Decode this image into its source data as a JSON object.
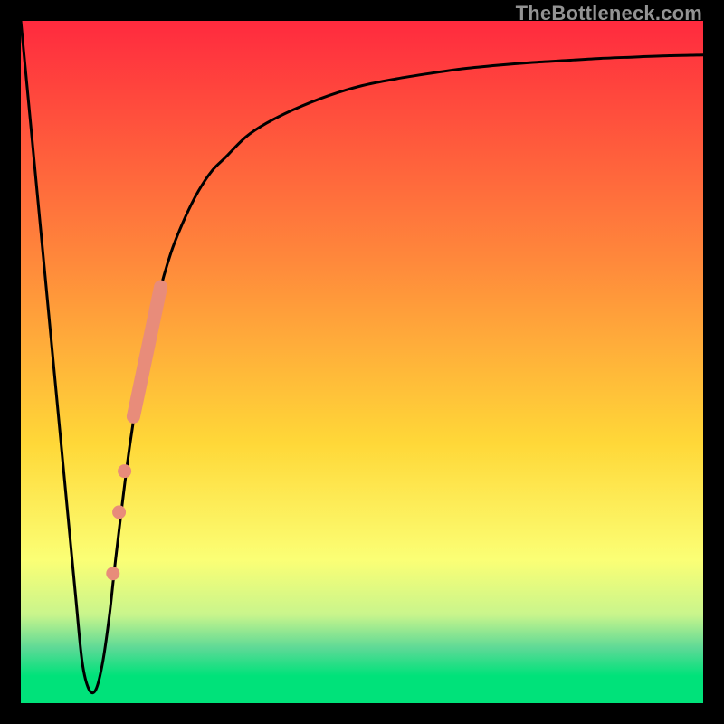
{
  "watermark": "TheBottleneck.com",
  "colors": {
    "frame": "#000000",
    "gradient_top": "#ff2a3e",
    "gradient_mid_upper": "#ff883b",
    "gradient_mid": "#ffd838",
    "gradient_mid_lower": "#fbff75",
    "gradient_low1": "#c9f58c",
    "gradient_low2": "#5bd996",
    "gradient_bottom": "#00e27a",
    "curve": "#000000",
    "marker": "#e88c7a"
  },
  "chart_data": {
    "type": "line",
    "title": "",
    "xlabel": "",
    "ylabel": "",
    "xlim": [
      0,
      100
    ],
    "ylim": [
      0,
      100
    ],
    "series": [
      {
        "name": "curve",
        "x": [
          0,
          2,
          4,
          6,
          8,
          9,
          10,
          11,
          12,
          13,
          14,
          16,
          18,
          20,
          22,
          24,
          26,
          28,
          30,
          33,
          36,
          40,
          45,
          50,
          55,
          60,
          65,
          70,
          75,
          80,
          85,
          90,
          95,
          100
        ],
        "y": [
          100,
          79,
          58,
          37,
          16,
          6,
          2,
          2,
          6,
          13,
          22,
          38,
          50,
          59,
          66,
          71,
          75,
          78,
          80,
          83,
          85,
          87,
          89,
          90.5,
          91.5,
          92.3,
          93,
          93.5,
          93.9,
          94.2,
          94.5,
          94.7,
          94.9,
          95
        ]
      }
    ],
    "markers": {
      "name": "thick-segment-and-dots",
      "segment": {
        "x": [
          16.5,
          20.5
        ],
        "y": [
          42,
          61
        ]
      },
      "dots": [
        {
          "x": 15.2,
          "y": 34
        },
        {
          "x": 14.4,
          "y": 28
        },
        {
          "x": 13.5,
          "y": 19
        }
      ]
    },
    "gradient_stops_pct": [
      0,
      35,
      62,
      79,
      87,
      92,
      96,
      100
    ]
  }
}
